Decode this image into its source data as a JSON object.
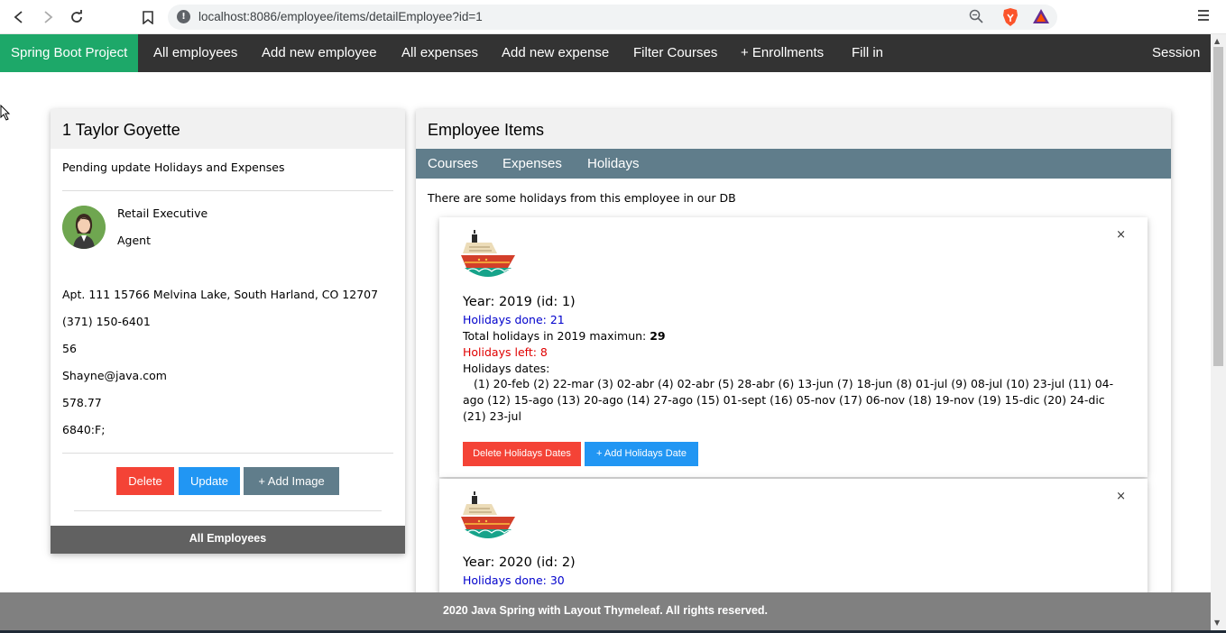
{
  "browser": {
    "url": "localhost:8086/employee/items/detailEmployee?id=1"
  },
  "navbar": {
    "brand": "Spring Boot Project",
    "items": [
      "All employees",
      "Add new employee",
      "All expenses",
      "Add new expense",
      "Filter Courses",
      "+ Enrollments",
      "Fill in"
    ],
    "session": "Session"
  },
  "employee": {
    "title": "1 Taylor Goyette",
    "pending": "Pending update Holidays and Expenses",
    "job_title": "Retail Executive",
    "role": "Agent",
    "address": "Apt. 111 15766 Melvina Lake, South Harland, CO 12707",
    "phone": "(371) 150-6401",
    "age": "56",
    "email": "Shayne@java.com",
    "salary": "578.77",
    "code": "6840:F;",
    "buttons": {
      "delete": "Delete",
      "update": "Update",
      "add_image": "+ Add Image"
    },
    "all_employees": "All Employees"
  },
  "items_panel": {
    "title": "Employee Items",
    "tabs": [
      "Courses",
      "Expenses",
      "Holidays"
    ],
    "notice": "There are some holidays from this employee in our DB",
    "cards": [
      {
        "year": "Year: 2019 (id: 1)",
        "done": "Holidays done: 21",
        "total_label": "Total holidays in 2019 maximun: ",
        "total_value": "29",
        "left": "Holidays left: 8",
        "dates_label": "Holidays dates:",
        "dates": "(1) 20-feb (2) 22-mar (3) 02-abr (4) 02-abr (5) 28-abr (6) 13-jun (7) 18-jun (8) 01-jul (9) 08-jul (10) 23-jul (11) 04-ago (12) 15-ago (13) 20-ago (14) 27-ago (15) 01-sept (16) 05-nov (17) 06-nov (18) 19-nov (19) 15-dic (20) 24-dic (21) 23-jul",
        "delete_btn": "Delete Holidays Dates",
        "add_btn": "+ Add Holidays Date",
        "close": "×"
      },
      {
        "year": "Year: 2020 (id: 2)",
        "done": "Holidays done: 30",
        "close": "×"
      }
    ]
  },
  "footer": "2020 Java Spring with Layout Thymeleaf. All rights reserved.",
  "colors": {
    "brand": "#1da869",
    "navbar": "#333333",
    "tabs": "#607d8b",
    "delete": "#f44336",
    "update": "#2196f3",
    "footer": "#808080"
  }
}
